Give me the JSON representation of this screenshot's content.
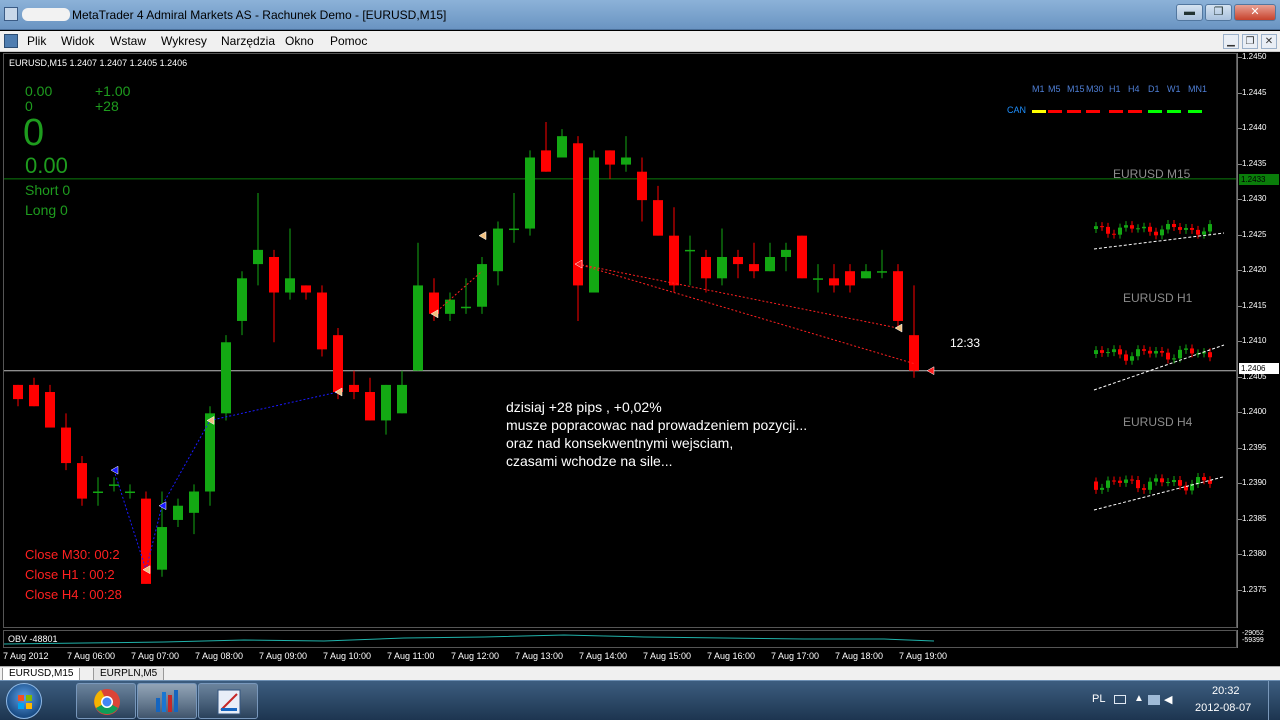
{
  "window": {
    "title": "MetaTrader 4 Admiral Markets AS - Rachunek Demo - [EURUSD,M15]",
    "buttons": {
      "minimize": "▬",
      "maximize": "❐",
      "close": "✕"
    },
    "mdi_buttons": {
      "minimize": "▁",
      "restore": "❐",
      "close": "✕"
    }
  },
  "menu": [
    "Plik",
    "Widok",
    "Wstaw",
    "Wykresy",
    "Narzędzia",
    "Okno",
    "Pomoc"
  ],
  "chart": {
    "header": "EURUSD,M15  1.2407 1.2407 1.2405 1.2406",
    "stats": {
      "a": "0.00",
      "b": "+1.00",
      "c": "0",
      "d": "+28",
      "big_zero": "0",
      "big_value": "0.00",
      "short": "Short  0",
      "long": "Long   0"
    },
    "timeframes": [
      "M1",
      "M5",
      "M15",
      "M30",
      "H1",
      "H4",
      "D1",
      "W1",
      "MN1"
    ],
    "can_label": "CAN",
    "can_colors": [
      "#ffff00",
      "#ff0000",
      "#ff0000",
      "#ff0000",
      "#ff0000",
      "#ff0000",
      "#00ff00",
      "#00ff00",
      "#00ff00"
    ],
    "mini_titles": {
      "m15": "EURUSD M15",
      "h1": "EURUSD H1",
      "h4": "EURUSD H4"
    },
    "countdown": "12:33",
    "note": [
      "dzisiaj +28 pips , +0,02%",
      "musze popracowac nad prowadzeniem pozycji...",
      "oraz nad konsekwentnymi wejsciam,",
      "czasami wchodze na sile..."
    ],
    "close_labels": [
      "Close M30:  00:2",
      "Close H1 :   00:2",
      "Close H4 :   00:28"
    ],
    "bull_color": "#13a813",
    "bear_color": "#ff0000"
  },
  "price_axis": {
    "ticks": [
      "1.2450",
      "1.2445",
      "1.2440",
      "1.2435",
      "1.2430",
      "1.2425",
      "1.2420",
      "1.2415",
      "1.2410",
      "1.2405",
      "1.2400",
      "1.2395",
      "1.2390",
      "1.2385",
      "1.2380",
      "1.2375"
    ],
    "tag_green": "1.2433",
    "tag_white": "1.2406"
  },
  "obv": {
    "label": "OBV -48801",
    "axis_top": "-29052",
    "axis_bottom": "-59399"
  },
  "time_axis": [
    "7 Aug 2012",
    "7 Aug 06:00",
    "7 Aug 07:00",
    "7 Aug 08:00",
    "7 Aug 09:00",
    "7 Aug 10:00",
    "7 Aug 11:00",
    "7 Aug 12:00",
    "7 Aug 13:00",
    "7 Aug 14:00",
    "7 Aug 15:00",
    "7 Aug 16:00",
    "7 Aug 17:00",
    "7 Aug 18:00",
    "7 Aug 19:00"
  ],
  "tabs": [
    "EURUSD,M15",
    "EURPLN,M5"
  ],
  "taskbar": {
    "lang": "PL",
    "time": "20:32",
    "date": "2012-08-07"
  },
  "candles": [
    {
      "o": 1.2404,
      "h": 1.2404,
      "l": 1.2401,
      "c": 1.2402
    },
    {
      "o": 1.2404,
      "h": 1.2405,
      "l": 1.2401,
      "c": 1.2401
    },
    {
      "o": 1.2403,
      "h": 1.2404,
      "l": 1.2398,
      "c": 1.2398
    },
    {
      "o": 1.2398,
      "h": 1.24,
      "l": 1.2392,
      "c": 1.2393
    },
    {
      "o": 1.2393,
      "h": 1.2394,
      "l": 1.2387,
      "c": 1.2388
    },
    {
      "o": 1.2389,
      "h": 1.2391,
      "l": 1.2387,
      "c": 1.2389
    },
    {
      "o": 1.239,
      "h": 1.2391,
      "l": 1.2389,
      "c": 1.239
    },
    {
      "o": 1.2389,
      "h": 1.239,
      "l": 1.2388,
      "c": 1.2389
    },
    {
      "o": 1.2388,
      "h": 1.2389,
      "l": 1.2376,
      "c": 1.2376
    },
    {
      "o": 1.2378,
      "h": 1.2389,
      "l": 1.2377,
      "c": 1.2384
    },
    {
      "o": 1.2385,
      "h": 1.2388,
      "l": 1.2384,
      "c": 1.2387
    },
    {
      "o": 1.2386,
      "h": 1.239,
      "l": 1.2383,
      "c": 1.2389
    },
    {
      "o": 1.2389,
      "h": 1.2401,
      "l": 1.2387,
      "c": 1.24
    },
    {
      "o": 1.24,
      "h": 1.2411,
      "l": 1.2399,
      "c": 1.241
    },
    {
      "o": 1.2413,
      "h": 1.242,
      "l": 1.2411,
      "c": 1.2419
    },
    {
      "o": 1.2421,
      "h": 1.2431,
      "l": 1.2418,
      "c": 1.2423
    },
    {
      "o": 1.2422,
      "h": 1.2423,
      "l": 1.241,
      "c": 1.2417
    },
    {
      "o": 1.2417,
      "h": 1.2426,
      "l": 1.2416,
      "c": 1.2419
    },
    {
      "o": 1.2418,
      "h": 1.2418,
      "l": 1.2416,
      "c": 1.2417
    },
    {
      "o": 1.2417,
      "h": 1.2418,
      "l": 1.2408,
      "c": 1.2409
    },
    {
      "o": 1.2411,
      "h": 1.2412,
      "l": 1.2402,
      "c": 1.2403
    },
    {
      "o": 1.2404,
      "h": 1.2406,
      "l": 1.2402,
      "c": 1.2403
    },
    {
      "o": 1.2403,
      "h": 1.2405,
      "l": 1.2399,
      "c": 1.2399
    },
    {
      "o": 1.2399,
      "h": 1.2404,
      "l": 1.2397,
      "c": 1.2404
    },
    {
      "o": 1.24,
      "h": 1.2406,
      "l": 1.24,
      "c": 1.2404
    },
    {
      "o": 1.2406,
      "h": 1.2424,
      "l": 1.2406,
      "c": 1.2418
    },
    {
      "o": 1.2417,
      "h": 1.2419,
      "l": 1.2413,
      "c": 1.2414
    },
    {
      "o": 1.2414,
      "h": 1.2417,
      "l": 1.2413,
      "c": 1.2416
    },
    {
      "o": 1.2415,
      "h": 1.2419,
      "l": 1.2414,
      "c": 1.2415
    },
    {
      "o": 1.2415,
      "h": 1.2422,
      "l": 1.2414,
      "c": 1.2421
    },
    {
      "o": 1.242,
      "h": 1.2427,
      "l": 1.2418,
      "c": 1.2426
    },
    {
      "o": 1.2426,
      "h": 1.2431,
      "l": 1.2424,
      "c": 1.2426
    },
    {
      "o": 1.2426,
      "h": 1.2437,
      "l": 1.2425,
      "c": 1.2436
    },
    {
      "o": 1.2437,
      "h": 1.2441,
      "l": 1.2434,
      "c": 1.2434
    },
    {
      "o": 1.2436,
      "h": 1.244,
      "l": 1.2436,
      "c": 1.2439
    },
    {
      "o": 1.2438,
      "h": 1.2439,
      "l": 1.2413,
      "c": 1.2418
    },
    {
      "o": 1.2417,
      "h": 1.2437,
      "l": 1.2417,
      "c": 1.2436
    },
    {
      "o": 1.2437,
      "h": 1.2437,
      "l": 1.2433,
      "c": 1.2435
    },
    {
      "o": 1.2435,
      "h": 1.2439,
      "l": 1.2434,
      "c": 1.2436
    },
    {
      "o": 1.2434,
      "h": 1.2436,
      "l": 1.2427,
      "c": 1.243
    },
    {
      "o": 1.243,
      "h": 1.2432,
      "l": 1.2425,
      "c": 1.2425
    },
    {
      "o": 1.2425,
      "h": 1.2429,
      "l": 1.2417,
      "c": 1.2418
    },
    {
      "o": 1.2423,
      "h": 1.2425,
      "l": 1.2418,
      "c": 1.2423
    },
    {
      "o": 1.2422,
      "h": 1.2423,
      "l": 1.2417,
      "c": 1.2419
    },
    {
      "o": 1.2419,
      "h": 1.2426,
      "l": 1.2418,
      "c": 1.2422
    },
    {
      "o": 1.2422,
      "h": 1.2423,
      "l": 1.2419,
      "c": 1.2421
    },
    {
      "o": 1.2421,
      "h": 1.2424,
      "l": 1.2419,
      "c": 1.242
    },
    {
      "o": 1.242,
      "h": 1.2424,
      "l": 1.242,
      "c": 1.2422
    },
    {
      "o": 1.2422,
      "h": 1.2424,
      "l": 1.242,
      "c": 1.2423
    },
    {
      "o": 1.2425,
      "h": 1.2425,
      "l": 1.2419,
      "c": 1.2419
    },
    {
      "o": 1.2419,
      "h": 1.2421,
      "l": 1.2417,
      "c": 1.2419
    },
    {
      "o": 1.2419,
      "h": 1.2421,
      "l": 1.2417,
      "c": 1.2418
    },
    {
      "o": 1.242,
      "h": 1.2421,
      "l": 1.2417,
      "c": 1.2418
    },
    {
      "o": 1.2419,
      "h": 1.2421,
      "l": 1.2419,
      "c": 1.242
    },
    {
      "o": 1.242,
      "h": 1.2423,
      "l": 1.2419,
      "c": 1.242
    },
    {
      "o": 1.242,
      "h": 1.2421,
      "l": 1.2412,
      "c": 1.2413
    },
    {
      "o": 1.2411,
      "h": 1.2418,
      "l": 1.2405,
      "c": 1.2406
    }
  ]
}
